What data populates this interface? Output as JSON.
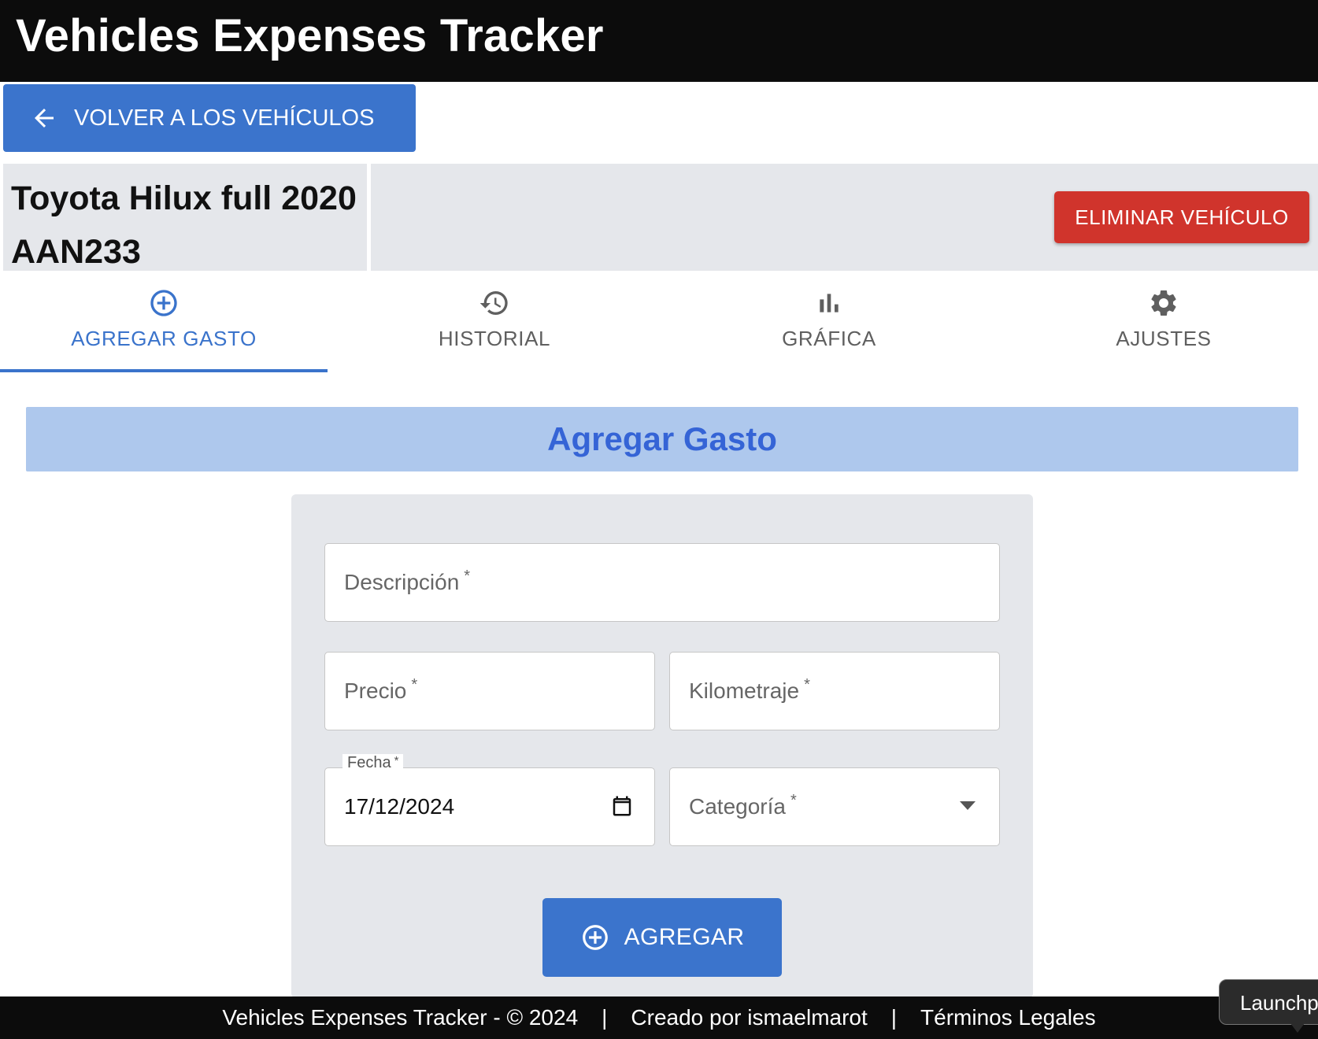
{
  "app": {
    "title": "Vehicles Expenses Tracker"
  },
  "nav": {
    "back_label": "VOLVER A LOS VEHÍCULOS"
  },
  "vehicle": {
    "name": "Toyota Hilux full 2020",
    "plate": "AAN233",
    "delete_label": "ELIMINAR VEHÍCULO"
  },
  "tabs": [
    {
      "label": "AGREGAR GASTO",
      "icon": "plus-circle-icon",
      "active": true
    },
    {
      "label": "HISTORIAL",
      "icon": "history-icon",
      "active": false
    },
    {
      "label": "GRÁFICA",
      "icon": "bar-chart-icon",
      "active": false
    },
    {
      "label": "AJUSTES",
      "icon": "gear-icon",
      "active": false
    }
  ],
  "form": {
    "title": "Agregar Gasto",
    "description_label": "Descripción",
    "price_label": "Precio",
    "mileage_label": "Kilometraje",
    "date_label": "Fecha",
    "date_value": "17/12/2024",
    "category_label": "Categoría",
    "required_mark": "*",
    "submit_label": "AGREGAR"
  },
  "footer": {
    "copyright": "Vehicles Expenses Tracker - © 2024",
    "separator": "|",
    "author": "Creado por ismaelmarot",
    "legal": "Términos Legales"
  },
  "launch": {
    "label": "Launchpad"
  },
  "colors": {
    "primary": "#3b74cc",
    "danger": "#d0342c",
    "header_bg": "#0c0c0c",
    "panel_bg": "#e5e7eb",
    "section_bg": "#aec8ed",
    "section_text": "#3564d6"
  }
}
